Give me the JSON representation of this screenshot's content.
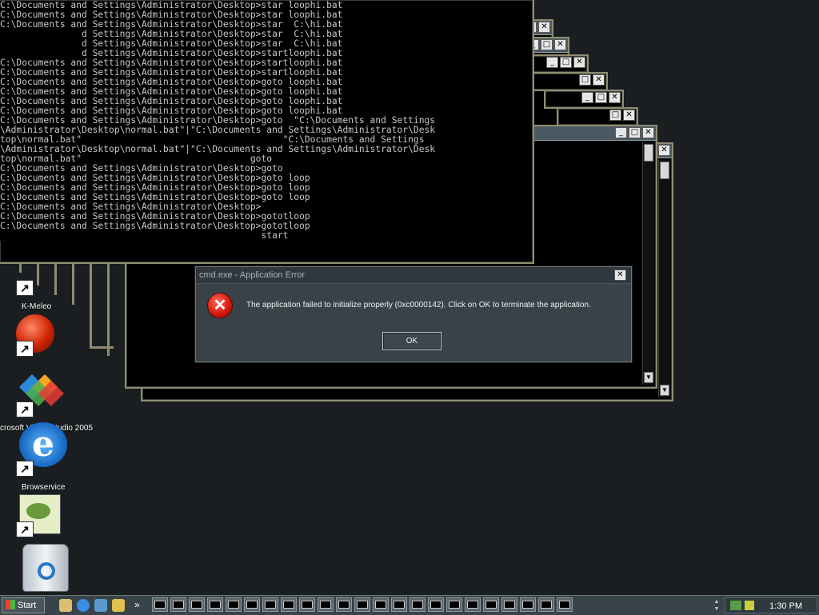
{
  "console": {
    "lines": [
      "C:\\Documents and Settings\\Administrator\\Desktop>star loophi.bat",
      "C:\\Documents and Settings\\Administrator\\Desktop>star loophi.bat",
      "C:\\Documents and Settings\\Administrator\\Desktop>star  C:\\hi.bat",
      "               d Settings\\Administrator\\Desktop>star  C:\\hi.bat",
      "               d Settings\\Administrator\\Desktop>star  C:\\hi.bat",
      "               d Settings\\Administrator\\Desktop>startloophi.bat",
      "C:\\Documents and Settings\\Administrator\\Desktop>startloophi.bat",
      "C:\\Documents and Settings\\Administrator\\Desktop>startloophi.bat",
      "C:\\Documents and Settings\\Administrator\\Desktop>goto loophi.bat",
      "C:\\Documents and Settings\\Administrator\\Desktop>goto loophi.bat",
      "C:\\Documents and Settings\\Administrator\\Desktop>goto loophi.bat",
      "C:\\Documents and Settings\\Administrator\\Desktop>goto loophi.bat",
      "C:\\Documents and Settings\\Administrator\\Desktop>goto  \"C:\\Documents and Settings",
      "\\Administrator\\Desktop\\normal.bat\"|\"C:\\Documents and Settings\\Administrator\\Desk",
      "top\\normal.bat\"                                     \"C:\\Documents and Settings",
      "\\Administrator\\Desktop\\normal.bat\"|\"C:\\Documents and Settings\\Administrator\\Desk",
      "top\\normal.bat\"                               goto",
      "C:\\Documents and Settings\\Administrator\\Desktop>goto",
      "C:\\Documents and Settings\\Administrator\\Desktop>goto loop",
      "C:\\Documents and Settings\\Administrator\\Desktop>goto loop",
      "C:\\Documents and Settings\\Administrator\\Desktop>goto loop",
      "C:\\Documents and Settings\\Administrator\\Desktop>",
      "C:\\Documents and Settings\\Administrator\\Desktop>gototloop",
      "C:\\Documents and Settings\\Administrator\\Desktop>gototloop",
      "                                                start"
    ]
  },
  "desktop_icons": [
    {
      "label": "",
      "icon": "shortcut-arrow-icon"
    },
    {
      "label": "K-Meleo",
      "icon": "k-meleon-icon"
    },
    {
      "label": "crosoft Visual Studio 2005",
      "icon": "visual-studio-icon"
    },
    {
      "label": "",
      "icon": "internet-explorer-icon"
    },
    {
      "label": "Browservice",
      "icon": "browservice-icon"
    },
    {
      "label": "",
      "icon": "frog-editor-icon"
    },
    {
      "label": "",
      "icon": "recycle-bin-icon"
    }
  ],
  "dialog": {
    "title": "cmd.exe - Application Error",
    "message": "The application failed to initialize properly (0xc0000142). Click on OK to terminate the application.",
    "ok_label": "OK",
    "close_symbol": "✕"
  },
  "taskbar": {
    "start_label": "Start",
    "task_label": "C:\\",
    "task_count": 23,
    "clock": "1:30 PM",
    "overflow_symbol": "»"
  },
  "window_controls": {
    "min": "_",
    "max": "□",
    "close": "✕"
  },
  "colors": {
    "desktop": "#1a1e20",
    "dialog": "#384248",
    "taskbar": "#39444a",
    "frame": "#8f8c70"
  }
}
